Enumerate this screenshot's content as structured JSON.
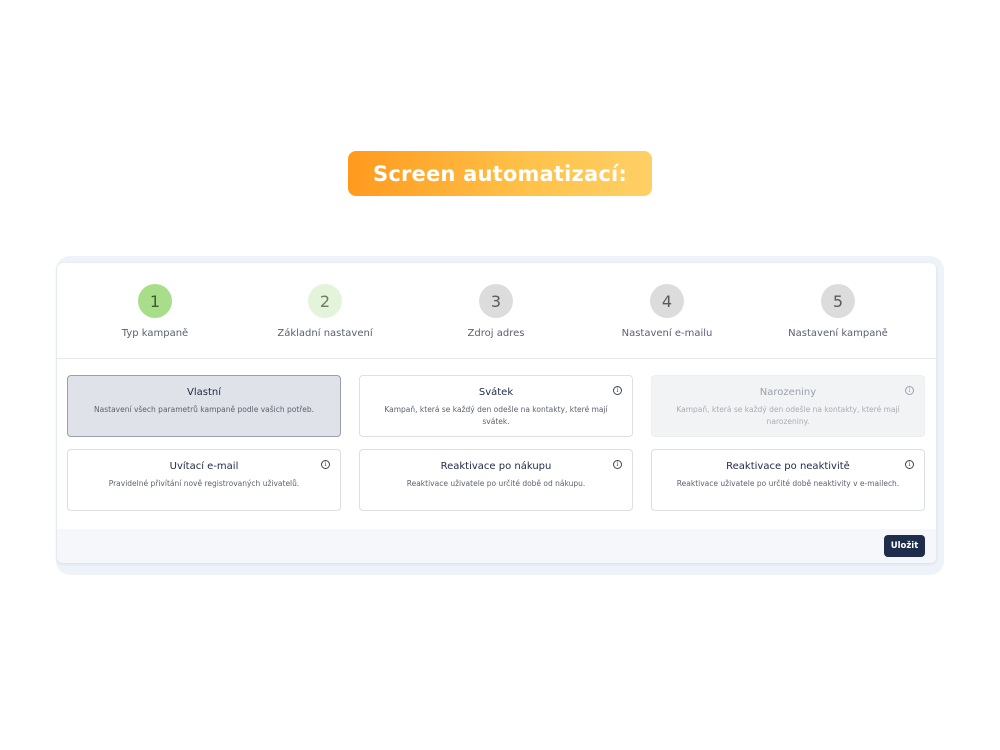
{
  "banner": {
    "title": "Screen automatizací:"
  },
  "steps": [
    {
      "number": "1",
      "label": "Typ kampaně",
      "color": "#a8dd8a",
      "text_color": "#3d5a33"
    },
    {
      "number": "2",
      "label": "Základní nastavení",
      "color": "#e3f4da",
      "text_color": "#6a7a64"
    },
    {
      "number": "3",
      "label": "Zdroj adres",
      "color": "#dcdcdc",
      "text_color": "#5a5a5a"
    },
    {
      "number": "4",
      "label": "Nastavení e-mailu",
      "color": "#dcdcdc",
      "text_color": "#5a5a5a"
    },
    {
      "number": "5",
      "label": "Nastavení kampaně",
      "color": "#dcdcdc",
      "text_color": "#5a5a5a"
    }
  ],
  "options": [
    {
      "title": "Vlastní",
      "description": "Nastavení všech parametrů kampaně podle vašich potřeb.",
      "state": "selected",
      "info": ""
    },
    {
      "title": "Svátek",
      "description": "Kampaň, která se každý den odešle na kontakty, které mají svátek.",
      "state": "normal",
      "info": "i"
    },
    {
      "title": "Narozeniny",
      "description": "Kampaň, která se každý den odešle na kontakty, které mají narozeniny.",
      "state": "disabled",
      "info": "i"
    },
    {
      "title": "Uvítací e-mail",
      "description": "Pravidelné přivítání nově registrovaných uživatelů.",
      "state": "normal",
      "info": "i"
    },
    {
      "title": "Reaktivace po nákupu",
      "description": "Reaktivace uživatele po určité době od nákupu.",
      "state": "normal",
      "info": "i"
    },
    {
      "title": "Reaktivace po neaktivitě",
      "description": "Reaktivace uživatele po určité době neaktivity v e-mailech.",
      "state": "normal",
      "info": "i"
    }
  ],
  "footer": {
    "save_label": "Uložit"
  }
}
